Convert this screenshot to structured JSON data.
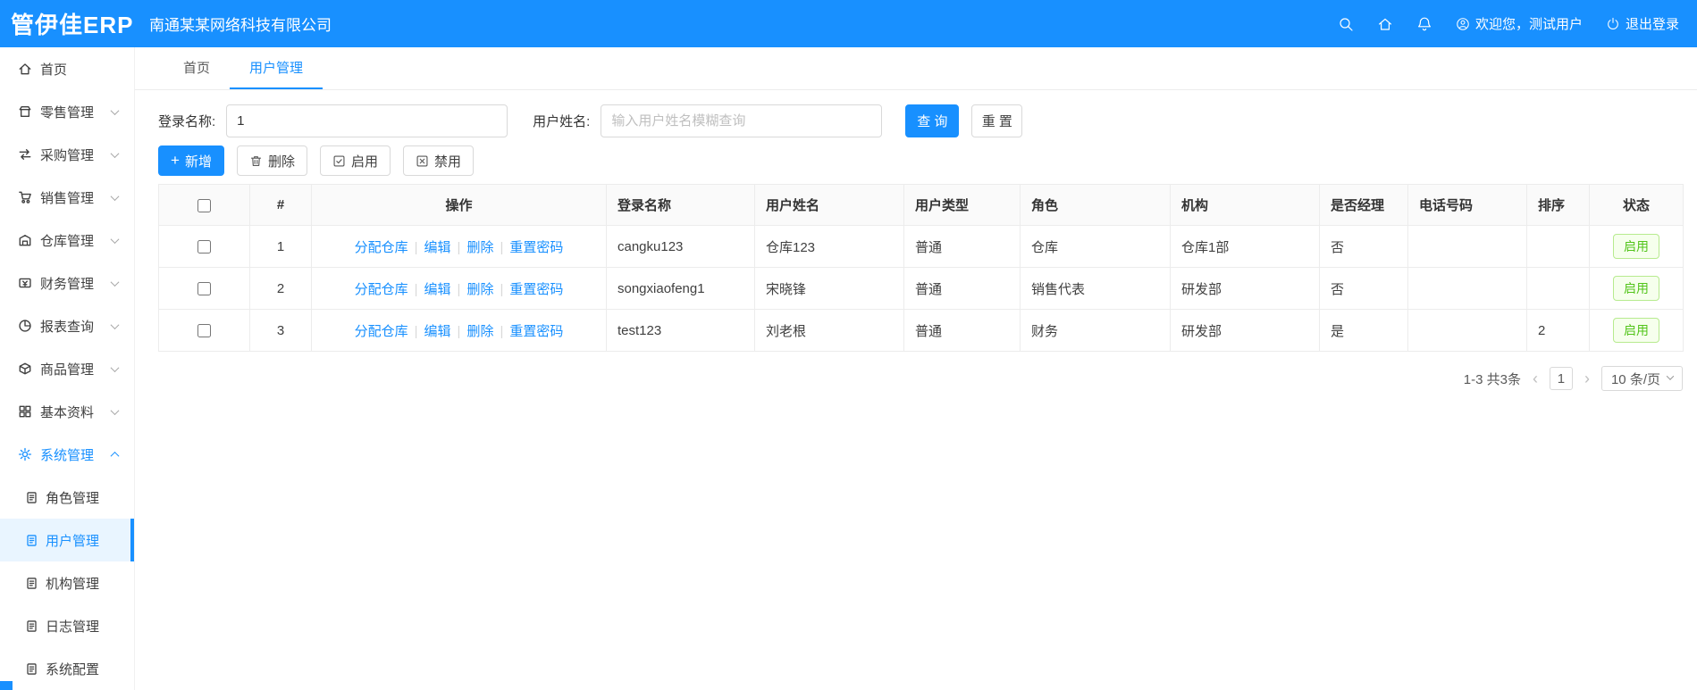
{
  "colors": {
    "primary": "#1890ff",
    "success_text": "#52c41a",
    "success_border": "#b7eb8f",
    "success_bg": "#f6ffed"
  },
  "header": {
    "logo": "管伊佳ERP",
    "company": "南通某某网络科技有限公司",
    "icons": [
      "search-icon",
      "home-icon",
      "bell-icon"
    ],
    "welcome": "欢迎您，测试用户",
    "welcome_icon": "user-circle-icon",
    "logout": "退出登录",
    "logout_icon": "power-icon"
  },
  "sidebar": {
    "items": [
      {
        "key": "home",
        "label": "首页",
        "icon": "home-icon",
        "expandable": false,
        "active": false
      },
      {
        "key": "retail",
        "label": "零售管理",
        "icon": "shop-icon",
        "expandable": true,
        "active": false
      },
      {
        "key": "purchase",
        "label": "采购管理",
        "icon": "swap-icon",
        "expandable": true,
        "active": false
      },
      {
        "key": "sales",
        "label": "销售管理",
        "icon": "cart-icon",
        "expandable": true,
        "active": false
      },
      {
        "key": "warehouse",
        "label": "仓库管理",
        "icon": "warehouse-icon",
        "expandable": true,
        "active": false
      },
      {
        "key": "finance",
        "label": "财务管理",
        "icon": "money-icon",
        "expandable": true,
        "active": false
      },
      {
        "key": "report",
        "label": "报表查询",
        "icon": "pie-chart-icon",
        "expandable": true,
        "active": false
      },
      {
        "key": "goods",
        "label": "商品管理",
        "icon": "box-icon",
        "expandable": true,
        "active": false
      },
      {
        "key": "basic-data",
        "label": "基本资料",
        "icon": "grid-icon",
        "expandable": true,
        "active": false
      },
      {
        "key": "system",
        "label": "系统管理",
        "icon": "gear-icon",
        "expandable": true,
        "expanded": true,
        "active": true,
        "children": [
          {
            "key": "role",
            "label": "角色管理",
            "icon": "doc-icon",
            "active": false
          },
          {
            "key": "user",
            "label": "用户管理",
            "icon": "doc-icon",
            "active": true
          },
          {
            "key": "org",
            "label": "机构管理",
            "icon": "doc-icon",
            "active": false
          },
          {
            "key": "log",
            "label": "日志管理",
            "icon": "doc-icon",
            "active": false
          },
          {
            "key": "config",
            "label": "系统配置",
            "icon": "doc-icon",
            "active": false
          }
        ]
      }
    ]
  },
  "tabs": [
    {
      "label": "首页",
      "active": false
    },
    {
      "label": "用户管理",
      "active": true
    }
  ],
  "filter": {
    "fields": [
      {
        "label": "登录名称:",
        "value": "1"
      },
      {
        "label": "用户姓名:",
        "placeholder": "输入用户姓名模糊查询"
      }
    ],
    "search_label": "查 询",
    "reset_label": "重 置"
  },
  "toolbar": {
    "buttons": [
      {
        "label": "新增",
        "icon": "plus-icon",
        "primary": true
      },
      {
        "label": "删除",
        "icon": "trash-icon",
        "primary": false
      },
      {
        "label": "启用",
        "icon": "check-square-icon",
        "primary": false
      },
      {
        "label": "禁用",
        "icon": "x-square-icon",
        "primary": false
      }
    ]
  },
  "table": {
    "headers": [
      "#",
      "操作",
      "登录名称",
      "用户姓名",
      "用户类型",
      "角色",
      "机构",
      "是否经理",
      "电话号码",
      "排序",
      "状态"
    ],
    "op_links": [
      "分配仓库",
      "编辑",
      "删除",
      "重置密码"
    ],
    "rows": [
      {
        "index": "1",
        "login": "cangku123",
        "name": "仓库123",
        "type": "普通",
        "role": "仓库",
        "org": "仓库1部",
        "manager": "否",
        "phone": "",
        "sort": "",
        "status": "启用"
      },
      {
        "index": "2",
        "login": "songxiaofeng1",
        "name": "宋晓锋",
        "type": "普通",
        "role": "销售代表",
        "org": "研发部",
        "manager": "否",
        "phone": "",
        "sort": "",
        "status": "启用"
      },
      {
        "index": "3",
        "login": "test123",
        "name": "刘老根",
        "type": "普通",
        "role": "财务",
        "org": "研发部",
        "manager": "是",
        "phone": "",
        "sort": "2",
        "status": "启用"
      }
    ]
  },
  "pagination": {
    "summary": "1-3 共3条",
    "prev": "‹",
    "current_page": "1",
    "next": "›",
    "page_size_label": "10 条/页"
  }
}
